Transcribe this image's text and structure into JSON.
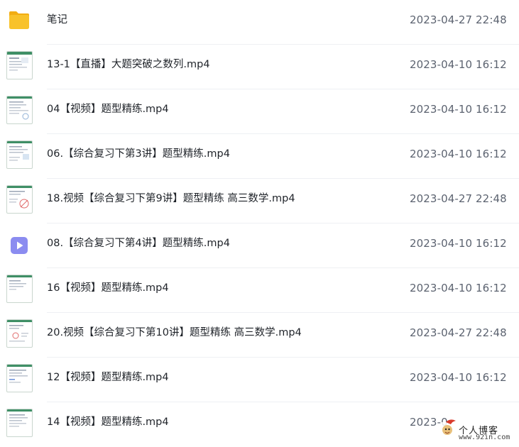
{
  "files": [
    {
      "name": "笔记",
      "date": "2023-04-27 22:48",
      "icon": "folder-icon"
    },
    {
      "name": "13-1【直播】大题突破之数列.mp4",
      "date": "2023-04-10 16:12",
      "icon": "video-thumbnail"
    },
    {
      "name": "04【视频】题型精练.mp4",
      "date": "2023-04-10 16:12",
      "icon": "video-thumbnail"
    },
    {
      "name": "06.【综合复习下第3讲】题型精练.mp4",
      "date": "2023-04-10 16:12",
      "icon": "video-thumbnail"
    },
    {
      "name": "18.视频【综合复习下第9讲】题型精练 高三数学.mp4",
      "date": "2023-04-27 22:48",
      "icon": "video-thumbnail"
    },
    {
      "name": "08.【综合复习下第4讲】题型精练.mp4",
      "date": "2023-04-10 16:12",
      "icon": "play-video-icon"
    },
    {
      "name": "16【视频】题型精练.mp4",
      "date": "2023-04-10 16:12",
      "icon": "video-thumbnail"
    },
    {
      "name": "20.视频【综合复习下第10讲】题型精练 高三数学.mp4",
      "date": "2023-04-27 22:48",
      "icon": "video-thumbnail"
    },
    {
      "name": "12【视频】题型精练.mp4",
      "date": "2023-04-10 16:12",
      "icon": "video-thumbnail"
    },
    {
      "name": "14【视频】题型精练.mp4",
      "date": "2023-0",
      "icon": "video-thumbnail"
    }
  ],
  "watermark": {
    "title": "个人博客",
    "url": "www.92in.com"
  },
  "colors": {
    "folder": "#f8c22b",
    "folder_back": "#f2ad13",
    "video_icon": "#8b8cf0",
    "thumb_border": "#c9d6ce",
    "date_text": "#5c6370"
  }
}
